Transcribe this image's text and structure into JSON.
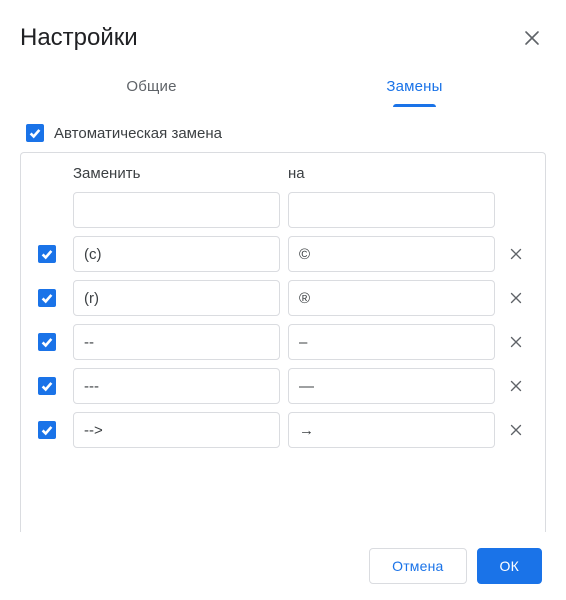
{
  "dialog": {
    "title": "Настройки"
  },
  "tabs": {
    "general": "Общие",
    "substitutions": "Замены"
  },
  "auto_replace": {
    "label": "Автоматическая замена",
    "checked": true
  },
  "columns": {
    "replace": "Заменить",
    "with": "на"
  },
  "rows": [
    {
      "checked": true,
      "from": "(c)",
      "to": "©"
    },
    {
      "checked": true,
      "from": "(r)",
      "to": "®"
    },
    {
      "checked": true,
      "from": "--",
      "to": "–"
    },
    {
      "checked": true,
      "from": "---",
      "to": "—"
    },
    {
      "checked": true,
      "from": "-->",
      "to": "→"
    }
  ],
  "buttons": {
    "cancel": "Отмена",
    "ok": "ОК"
  }
}
